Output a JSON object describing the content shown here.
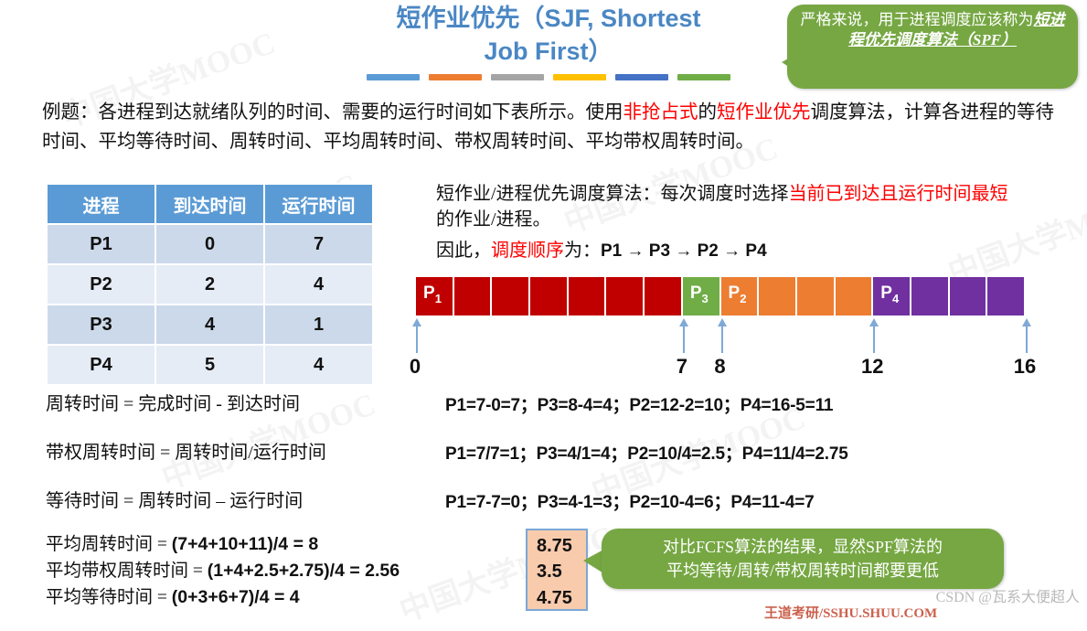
{
  "title": {
    "line1": "短作业优先（SJF, Shortest",
    "line2": "Job First）",
    "bars": [
      "#5b9bd5",
      "#ed7d31",
      "#a5a5a5",
      "#ffc000",
      "#4472c4",
      "#70ad47"
    ]
  },
  "callouts": {
    "spf": {
      "plain": "严格来说，用于进程调度应该称为",
      "emphasis": "短进程优先调度算法（SPF）"
    },
    "compare": {
      "line1": "对比FCFS算法的结果，显然SPF算法的",
      "line2": "平均等待/周转/带权周转时间都要更低"
    }
  },
  "intro": {
    "part1": "例题：各进程到达就绪队列的时间、需要的运行时间如下表所示。使用",
    "red1": "非抢占式",
    "part2": "的",
    "red2": "短作业优先",
    "part3": "调度算法，计算各进程的等待时间、平均等待时间、周转时间、平均周转时间、带权周转时间、平均带权周转时间。"
  },
  "table": {
    "headers": [
      "进程",
      "到达时间",
      "运行时间"
    ],
    "rows": [
      [
        "P1",
        "0",
        "7"
      ],
      [
        "P2",
        "2",
        "4"
      ],
      [
        "P3",
        "4",
        "1"
      ],
      [
        "P4",
        "5",
        "4"
      ]
    ]
  },
  "algo_note": {
    "lead": "短作业/进程优先调度算法：每次调度时选择",
    "red": "当前已到达且运行时间最短",
    "tail": "的作业/进程。",
    "order_prefix": "因此，",
    "order_red": "调度顺序",
    "order_mid": "为：",
    "order_value": "P1 → P3 → P2 → P4"
  },
  "gantt": {
    "total": 16,
    "segments": [
      {
        "label": "P",
        "sub": "1",
        "start": 0,
        "end": 7,
        "color": "#c00000",
        "blocks": 7
      },
      {
        "label": "P",
        "sub": "3",
        "start": 7,
        "end": 8,
        "color": "#70ad47",
        "blocks": 1
      },
      {
        "label": "P",
        "sub": "2",
        "start": 8,
        "end": 12,
        "color": "#ed7d31",
        "blocks": 4
      },
      {
        "label": "P",
        "sub": "4",
        "start": 12,
        "end": 16,
        "color": "#7030a0",
        "blocks": 4
      }
    ],
    "ticks": [
      {
        "value": 0,
        "label": "0"
      },
      {
        "value": 7,
        "label": "7"
      },
      {
        "value": 8,
        "label": "8"
      },
      {
        "value": 12,
        "label": "12"
      },
      {
        "value": 16,
        "label": "16"
      }
    ]
  },
  "formulas": [
    "周转时间 = 完成时间 - 到达时间",
    "带权周转时间 = 周转时间/运行时间",
    "等待时间 = 周转时间 – 运行时间"
  ],
  "calcs": [
    "P1=7-0=7；P3=8-4=4；P2=12-2=10；P4=16-5=11",
    "P1=7/7=1；P3=4/1=4；P2=10/4=2.5；P4=11/4=2.75",
    "P1=7-7=0；P3=4-1=3；P2=10-4=6；P4=11-4=7"
  ],
  "averages": [
    {
      "label": "平均周转时间 = ",
      "value": "(7+4+10+11)/4 = 8"
    },
    {
      "label": "平均带权周转时间 = ",
      "value": "(1+4+2.5+2.75)/4 = 2.56"
    },
    {
      "label": "平均等待时间 = ",
      "value": "(0+3+6+7)/4 = 4"
    }
  ],
  "fcfs_box": [
    "8.75",
    "3.5",
    "4.75"
  ],
  "watermark": {
    "text_a": "中国大学MOOC",
    "text_b": "中国大学MOOC"
  },
  "csdn": "CSDN @瓦系大便超人",
  "bottom_cut": "王道考研/SSHU.SHUU.COM"
}
